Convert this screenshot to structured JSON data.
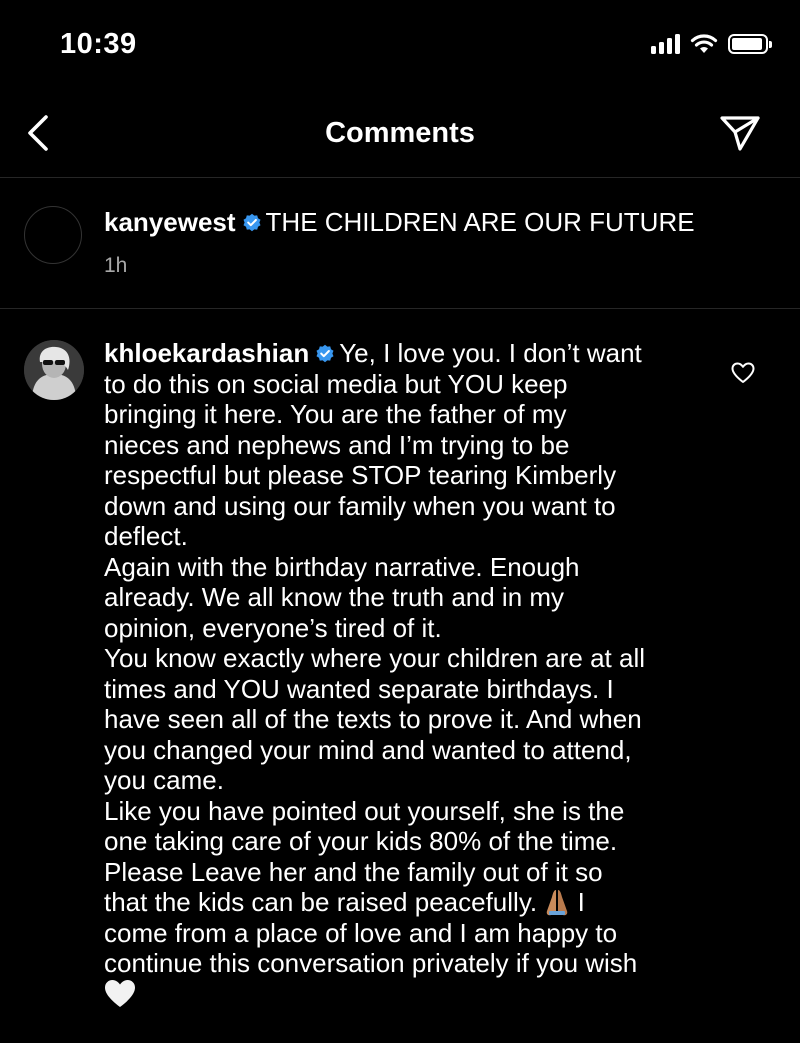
{
  "status_bar": {
    "time": "10:39"
  },
  "header": {
    "title": "Comments"
  },
  "caption": {
    "username": "kanyewest",
    "text": "THE CHILDREN ARE OUR FUTURE",
    "time": "1h"
  },
  "comment": {
    "username": "khloekardashian",
    "first_line": "Ye, I love you. I don’t want",
    "text_1": "to do this on social media but YOU keep\nbringing it here. You are the father of my\nnieces and nephews and I’m trying to be\nrespectful but please STOP tearing Kimberly\ndown and using our family when you want to\ndeflect.",
    "text_2": "Again with the birthday narrative. Enough\nalready. We all know the truth and in my\nopinion, everyone’s tired of it.",
    "text_3": "You know exactly where your children are at all\ntimes and YOU wanted separate birthdays. I\nhave seen all of the texts to prove it. And when\nyou changed your mind and wanted to attend,\nyou came.",
    "text_4a": "Like you have pointed out yourself, she is the\none taking care of your kids 80% of the time.\nPlease Leave her and the family out of it so\nthat the kids can be raised peacefully. ",
    "text_4b": " I\ncome from a place of love and I am happy to\ncontinue this conversation privately if you wish\n"
  },
  "icons": {
    "back": "chevron-left-icon",
    "send": "paper-plane-icon",
    "verified": "verified-badge-icon",
    "like": "heart-outline-icon",
    "pray_emoji": "folded-hands-emoji",
    "white_heart_emoji": "white-heart-emoji"
  },
  "colors": {
    "background": "#000000",
    "text": "#ffffff",
    "secondary": "#a8a8a8",
    "verified": "#3897f0",
    "divider": "#262626"
  }
}
